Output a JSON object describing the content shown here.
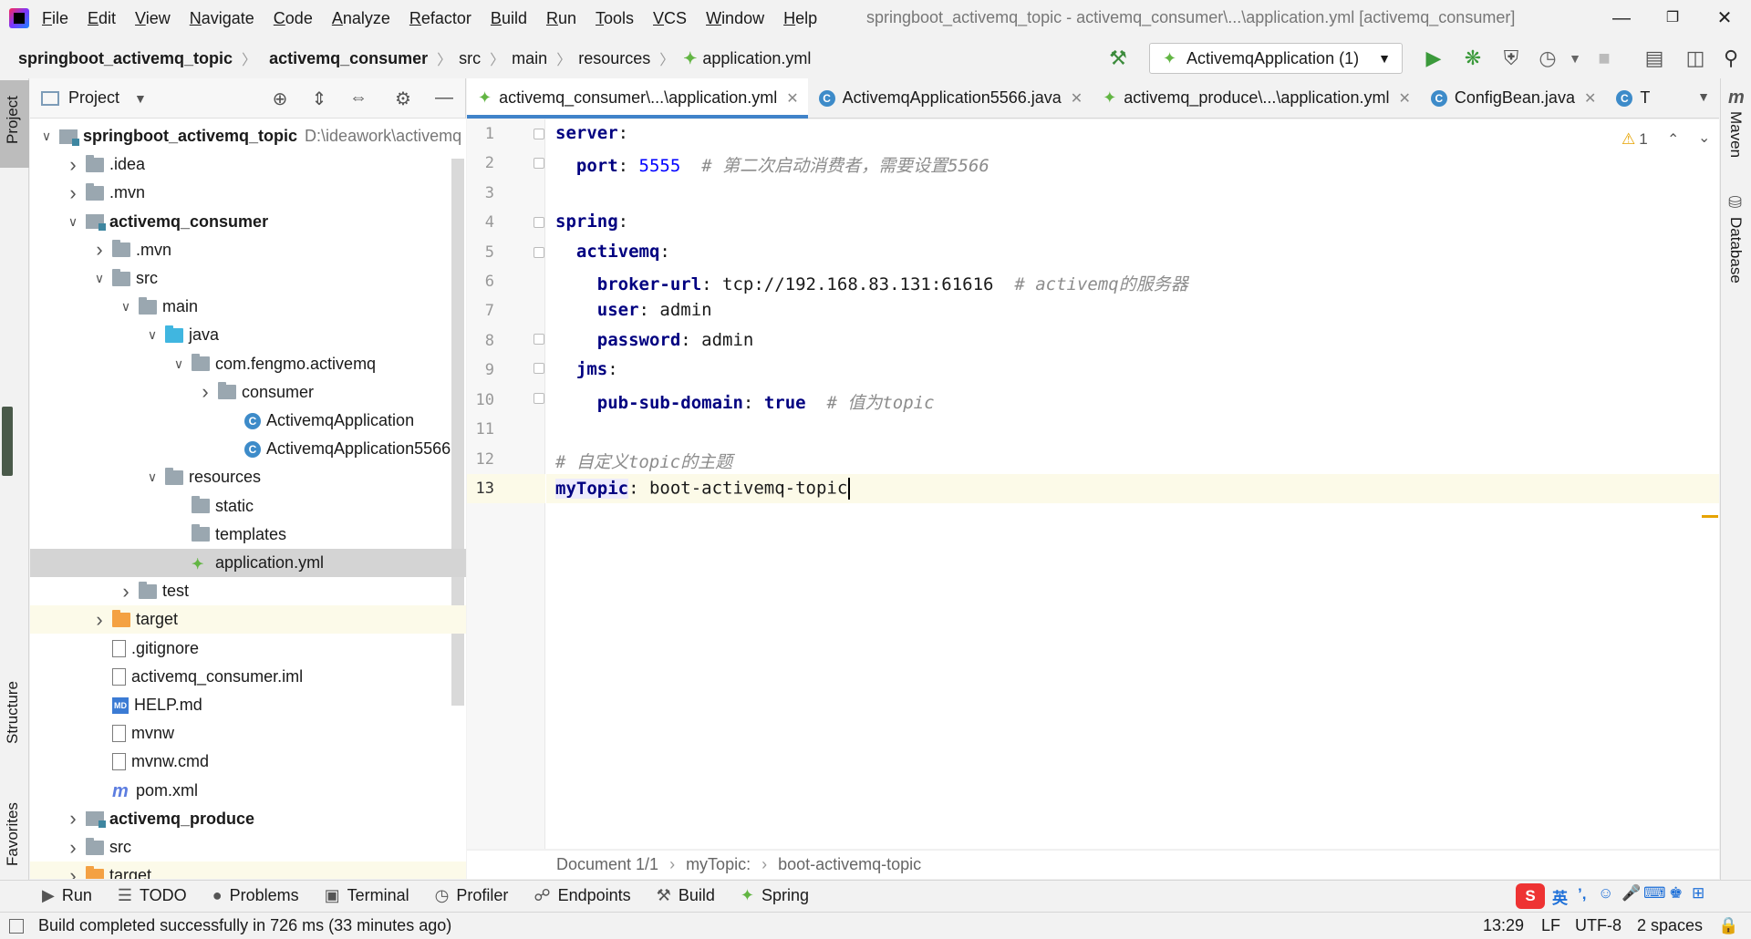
{
  "menu": {
    "items": [
      "File",
      "Edit",
      "View",
      "Navigate",
      "Code",
      "Analyze",
      "Refactor",
      "Build",
      "Run",
      "Tools",
      "VCS",
      "Window",
      "Help"
    ],
    "window_title": "springboot_activemq_topic - activemq_consumer\\...\\application.yml [activemq_consumer]"
  },
  "breadcrumb": [
    "springboot_activemq_topic",
    "activemq_consumer",
    "src",
    "main",
    "resources",
    "application.yml"
  ],
  "toolbar": {
    "run_config": "ActivemqApplication (1)"
  },
  "left_strip": {
    "project": "Project",
    "structure": "Structure",
    "favorites": "Favorites"
  },
  "right_strip": {
    "maven": "Maven",
    "database": "Database"
  },
  "project_panel": {
    "title": "Project",
    "root_path": "D:\\ideawork\\activemq",
    "tree": [
      {
        "label": "springboot_activemq_topic",
        "bold": true
      },
      {
        "label": ".idea"
      },
      {
        "label": ".mvn"
      },
      {
        "label": "activemq_consumer",
        "bold": true
      },
      {
        "label": ".mvn"
      },
      {
        "label": "src"
      },
      {
        "label": "main"
      },
      {
        "label": "java"
      },
      {
        "label": "com.fengmo.activemq"
      },
      {
        "label": "consumer"
      },
      {
        "label": "ActivemqApplication"
      },
      {
        "label": "ActivemqApplication5566"
      },
      {
        "label": "resources"
      },
      {
        "label": "static"
      },
      {
        "label": "templates"
      },
      {
        "label": "application.yml"
      },
      {
        "label": "test"
      },
      {
        "label": "target"
      },
      {
        "label": ".gitignore"
      },
      {
        "label": "activemq_consumer.iml"
      },
      {
        "label": "HELP.md"
      },
      {
        "label": "mvnw"
      },
      {
        "label": "mvnw.cmd"
      },
      {
        "label": "pom.xml"
      },
      {
        "label": "activemq_produce",
        "bold": true
      },
      {
        "label": "src"
      },
      {
        "label": "target"
      }
    ]
  },
  "tabs": [
    {
      "label": "activemq_consumer\\...\\application.yml",
      "active": true
    },
    {
      "label": "ActivemqApplication5566.java"
    },
    {
      "label": "activemq_produce\\...\\application.yml"
    },
    {
      "label": "ConfigBean.java"
    },
    {
      "label": "T"
    }
  ],
  "editor": {
    "line_numbers": [
      "1",
      "2",
      "3",
      "4",
      "5",
      "6",
      "7",
      "8",
      "9",
      "10",
      "11",
      "12",
      "13"
    ],
    "code": {
      "l1_key": "server",
      "l2_key": "port",
      "l2_val": "5555",
      "l2_cmt": "# 第二次启动消费者，需要设置5566",
      "l4_key": "spring",
      "l5_key": "activemq",
      "l6_key": "broker-url",
      "l6_val": "tcp://192.168.83.131:61616",
      "l6_cmt": "# activemq的服务器",
      "l7_key": "user",
      "l7_val": "admin",
      "l8_key": "password",
      "l8_val": "admin",
      "l9_key": "jms",
      "l10_key": "pub-sub-domain",
      "l10_val": "true",
      "l10_cmt": "# 值为topic",
      "l12_cmt": "# 自定义topic的主题",
      "l13_key": "myTopic",
      "l13_val": "boot-activemq-topic"
    },
    "warnings": "1",
    "status_breadcrumb": [
      "Document 1/1",
      "myTopic:",
      "boot-activemq-topic"
    ]
  },
  "bottom_tools": [
    "Run",
    "TODO",
    "Problems",
    "Terminal",
    "Profiler",
    "Endpoints",
    "Build",
    "Spring"
  ],
  "status": {
    "message": "Build completed successfully in 726 ms (33 minutes ago)",
    "position": "13:29",
    "line_sep": "LF",
    "encoding": "UTF-8",
    "indent": "2 spaces"
  },
  "ime": {
    "lang": "英"
  },
  "colors": {
    "accent": "#4083c9",
    "yaml_key": "#000080",
    "number": "#0000ff",
    "comment": "#8c8c8c"
  }
}
